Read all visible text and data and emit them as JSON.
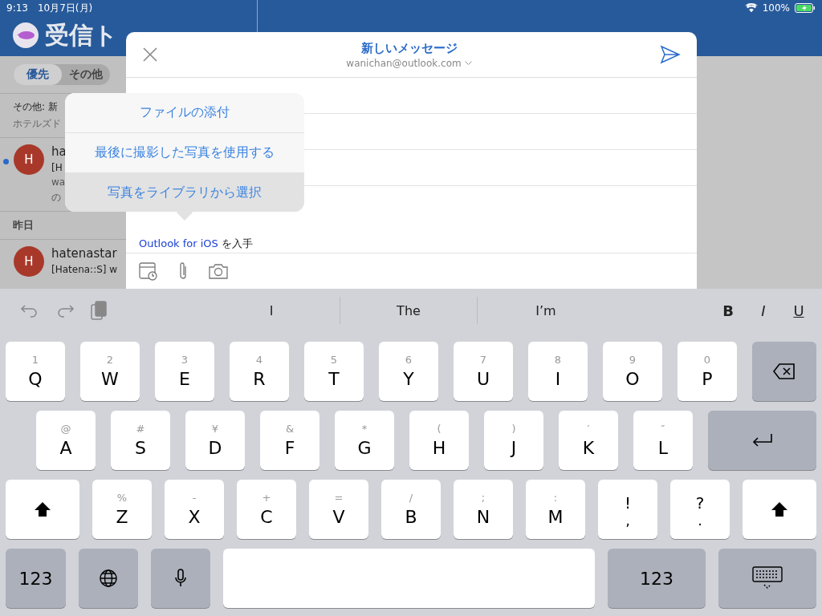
{
  "status_bar": {
    "time": "9:13",
    "date": "10月7日(月)",
    "battery": "100%"
  },
  "inbox": {
    "title": "受信ト",
    "filters": [
      {
        "label": "優先",
        "selected": true
      },
      {
        "label": "その他",
        "selected": false
      }
    ],
    "other_notice": {
      "title": "その他: 新",
      "preview": "ホテルズド"
    },
    "messages": [
      {
        "avatar": "H",
        "sender": "ha",
        "subject": "[H",
        "lines": [
          "wa",
          "の"
        ],
        "unread": true
      }
    ],
    "section": "昨日",
    "messages_yesterday": [
      {
        "avatar": "H",
        "sender": "hatenastar",
        "subject": "[Hatena::S] w",
        "unread": false
      }
    ]
  },
  "compose": {
    "title": "新しいメッセージ",
    "account": "wanichan@outlook.com",
    "signature_link": "Outlook for iOS",
    "signature_rest": " を入手"
  },
  "popup": {
    "items": [
      {
        "label": "ファイルの添付",
        "highlighted": false
      },
      {
        "label": "最後に撮影した写真を使用する",
        "highlighted": false
      },
      {
        "label": "写真をライブラリから選択",
        "highlighted": true
      }
    ]
  },
  "keyboard": {
    "suggestions": [
      "I",
      "The",
      "I’m"
    ],
    "format": [
      "B",
      "I",
      "U"
    ],
    "rows": [
      [
        {
          "kind": "letter",
          "hint": "1",
          "label": "Q"
        },
        {
          "kind": "letter",
          "hint": "2",
          "label": "W"
        },
        {
          "kind": "letter",
          "hint": "3",
          "label": "E"
        },
        {
          "kind": "letter",
          "hint": "4",
          "label": "R"
        },
        {
          "kind": "letter",
          "hint": "5",
          "label": "T"
        },
        {
          "kind": "letter",
          "hint": "6",
          "label": "Y"
        },
        {
          "kind": "letter",
          "hint": "7",
          "label": "U"
        },
        {
          "kind": "letter",
          "hint": "8",
          "label": "I"
        },
        {
          "kind": "letter",
          "hint": "9",
          "label": "O"
        },
        {
          "kind": "letter",
          "hint": "0",
          "label": "P"
        },
        {
          "kind": "delete"
        }
      ],
      [
        {
          "kind": "letter",
          "hint": "@",
          "label": "A"
        },
        {
          "kind": "letter",
          "hint": "#",
          "label": "S"
        },
        {
          "kind": "letter",
          "hint": "¥",
          "label": "D"
        },
        {
          "kind": "letter",
          "hint": "&",
          "label": "F"
        },
        {
          "kind": "letter",
          "hint": "*",
          "label": "G"
        },
        {
          "kind": "letter",
          "hint": "(",
          "label": "H"
        },
        {
          "kind": "letter",
          "hint": ")",
          "label": "J"
        },
        {
          "kind": "letter",
          "hint": "′",
          "label": "K"
        },
        {
          "kind": "letter",
          "hint": "″",
          "label": "L"
        },
        {
          "kind": "return"
        }
      ],
      [
        {
          "kind": "shift"
        },
        {
          "kind": "letter",
          "hint": "%",
          "label": "Z"
        },
        {
          "kind": "letter",
          "hint": "-",
          "label": "X"
        },
        {
          "kind": "letter",
          "hint": "+",
          "label": "C"
        },
        {
          "kind": "letter",
          "hint": "=",
          "label": "V"
        },
        {
          "kind": "letter",
          "hint": "/",
          "label": "B"
        },
        {
          "kind": "letter",
          "hint": ";",
          "label": "N"
        },
        {
          "kind": "letter",
          "hint": ":",
          "label": "M"
        },
        {
          "kind": "punct",
          "hint": "!",
          "label": ","
        },
        {
          "kind": "punct",
          "hint": "?",
          "label": "."
        },
        {
          "kind": "shift"
        }
      ],
      [
        {
          "kind": "mode",
          "label": "123"
        },
        {
          "kind": "globe"
        },
        {
          "kind": "mic"
        },
        {
          "kind": "space"
        },
        {
          "kind": "mode",
          "label": "123"
        },
        {
          "kind": "hide"
        }
      ]
    ]
  }
}
